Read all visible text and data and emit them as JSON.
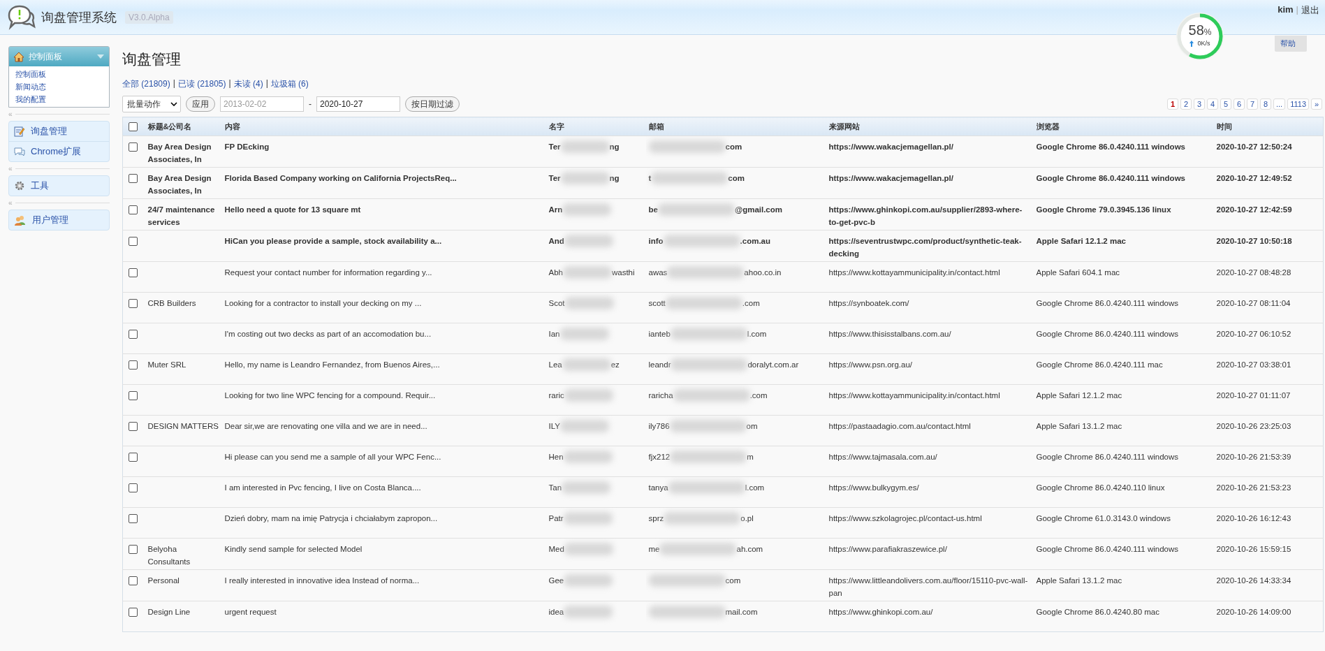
{
  "header": {
    "title": "询盘管理系统",
    "version": "V3.0.Alpha",
    "user": "kim",
    "separator": "|",
    "logout": "退出",
    "help": "帮助"
  },
  "monitor": {
    "percent": "58",
    "unit": "%",
    "level": 0.58,
    "speed": "0K/s"
  },
  "sidebar": {
    "panel": {
      "title": "控制面板",
      "items": [
        "控制面板",
        "新闻动态",
        "我的配置"
      ]
    },
    "groups": [
      {
        "collapse": "«",
        "items": [
          "询盘管理",
          "Chrome扩展"
        ]
      },
      {
        "collapse": "«",
        "items": [
          "工具"
        ]
      },
      {
        "collapse": "«",
        "items": [
          "用户管理"
        ]
      }
    ]
  },
  "page_title": "询盘管理",
  "filters": [
    {
      "label": "全部 (21809)"
    },
    {
      "sep": "|",
      "label": "已读 (21805)"
    },
    {
      "sep": "|",
      "label": "未读 (4)"
    },
    {
      "sep": "|",
      "label": "垃圾箱 (6)"
    }
  ],
  "toolbar": {
    "bulk_action": "批量动作",
    "apply": "应用",
    "date_from_placeholder": "2013-02-02",
    "dash": "-",
    "date_to": "2020-10-27",
    "filter_button": "按日期过滤"
  },
  "pagination": {
    "pages": [
      {
        "label": "1",
        "selected": true
      },
      {
        "label": "2",
        "selected": false
      },
      {
        "label": "3",
        "selected": false
      },
      {
        "label": "4",
        "selected": false
      },
      {
        "label": "5",
        "selected": false
      },
      {
        "label": "6",
        "selected": false
      },
      {
        "label": "7",
        "selected": false
      },
      {
        "label": "8",
        "selected": false
      },
      {
        "label": "...",
        "selected": false
      },
      {
        "label": "1113",
        "selected": false
      }
    ],
    "next": "»"
  },
  "table": {
    "select_all_checked": false,
    "columns": [
      "标题&公司名",
      "内容",
      "名字",
      "邮箱",
      "来源网站",
      "浏览器",
      "时间"
    ],
    "rows": [
      {
        "checked": false,
        "read": false,
        "company": "Bay Area Design Associates, In",
        "content": "FP DEcking",
        "name": {
          "start": "Ter",
          "end": "ng"
        },
        "email": {
          "end": "com"
        },
        "site": "https://www.wakacjemagellan.pl/",
        "browser": "Google Chrome 86.0.4240.111 windows",
        "time": "2020-10-27 12:50:24"
      },
      {
        "checked": false,
        "read": false,
        "company": "Bay Area Design Associates, In",
        "content": "Florida Based Company working on California ProjectsReq...",
        "name": {
          "start": "Ter",
          "end": "ng"
        },
        "email": {
          "start": "t",
          "end": "com"
        },
        "site": "https://www.wakacjemagellan.pl/",
        "browser": "Google Chrome 86.0.4240.111 windows",
        "time": "2020-10-27 12:49:52"
      },
      {
        "checked": false,
        "read": false,
        "company": "24/7 maintenance services",
        "content": "Hello need a quote for 13 square mt",
        "name": {
          "start": "Arn"
        },
        "email": {
          "start": "be",
          "end": "@gmail.com"
        },
        "site": "https://www.ghinkopi.com.au/supplier/2893-where-to-get-pvc-b",
        "browser": "Google Chrome 79.0.3945.136 linux",
        "time": "2020-10-27 12:42:59"
      },
      {
        "checked": false,
        "read": false,
        "content": "HiCan you please provide a sample, stock availability a...",
        "name": {
          "start": "And"
        },
        "email": {
          "start": "info",
          "end": ".com.au"
        },
        "site": "https://seventrustwpc.com/product/synthetic-teak-decking",
        "browser": "Apple Safari 12.1.2 mac",
        "time": "2020-10-27 10:50:18"
      },
      {
        "checked": false,
        "read": true,
        "content": "Request your contact number for information regarding y...",
        "name": {
          "start": "Abh",
          "end": "wasthi"
        },
        "email": {
          "start": "awas",
          "end": "ahoo.co.in"
        },
        "site": "https://www.kottayammunicipality.in/contact.html",
        "browser": "Apple Safari 604.1 mac",
        "time": "2020-10-27 08:48:28"
      },
      {
        "checked": false,
        "read": true,
        "company": "CRB Builders",
        "content": "Looking for a contractor to install your decking on my ...",
        "name": {
          "start": "Scot"
        },
        "email": {
          "start": "scott",
          "end": ".com"
        },
        "site": "https://synboatek.com/",
        "browser": "Google Chrome 86.0.4240.111 windows",
        "time": "2020-10-27 08:11:04"
      },
      {
        "checked": false,
        "read": true,
        "content": "I'm costing out two decks as part of an accomodation bu...",
        "name": {
          "start": "Ian"
        },
        "email": {
          "start": "ianteb",
          "end": "l.com"
        },
        "site": "https://www.thisisstalbans.com.au/",
        "browser": "Google Chrome 86.0.4240.111 windows",
        "time": "2020-10-27 06:10:52"
      },
      {
        "checked": false,
        "read": true,
        "company": "Muter SRL",
        "content": "Hello, my name is Leandro Fernandez, from Buenos Aires,...",
        "name": {
          "start": "Lea",
          "end": "ez"
        },
        "email": {
          "start": "leandr",
          "end": "doralyt.com.ar"
        },
        "site": "https://www.psn.org.au/",
        "browser": "Google Chrome 86.0.4240.111 mac",
        "time": "2020-10-27 03:38:01"
      },
      {
        "checked": false,
        "read": true,
        "content": "Looking for two line WPC fencing for a compound. Requir...",
        "name": {
          "start": "raric"
        },
        "email": {
          "start": "raricha",
          "end": ".com"
        },
        "site": "https://www.kottayammunicipality.in/contact.html",
        "browser": "Apple Safari 12.1.2 mac",
        "time": "2020-10-27 01:11:07"
      },
      {
        "checked": false,
        "read": true,
        "company": "DESIGN MATTERS",
        "content": "Dear sir,we are renovating one villa and we are in need...",
        "name": {
          "start": "ILY"
        },
        "email": {
          "start": "ily786",
          "end": "om"
        },
        "site": "https://pastaadagio.com.au/contact.html",
        "browser": "Apple Safari 13.1.2 mac",
        "time": "2020-10-26 23:25:03"
      },
      {
        "checked": false,
        "read": true,
        "content": "Hi please can you send me a sample of all your WPC Fenc...",
        "name": {
          "start": "Hen"
        },
        "email": {
          "start": "fjx212",
          "end": "m"
        },
        "site": "https://www.tajmasala.com.au/",
        "browser": "Google Chrome 86.0.4240.111 windows",
        "time": "2020-10-26 21:53:39"
      },
      {
        "checked": false,
        "read": true,
        "content": "I am interested in Pvc fencing, I live on Costa Blanca....",
        "name": {
          "start": "Tan"
        },
        "email": {
          "start": "tanya",
          "end": "l.com"
        },
        "site": "https://www.bulkygym.es/",
        "browser": "Google Chrome 86.0.4240.110 linux",
        "time": "2020-10-26 21:53:23"
      },
      {
        "checked": false,
        "read": true,
        "content": "Dzień dobry, mam na imię Patrycja i chciałabym zapropon...",
        "name": {
          "start": "Patr"
        },
        "email": {
          "start": "sprz",
          "end": "o.pl"
        },
        "site": "https://www.szkolagrojec.pl/contact-us.html",
        "browser": "Google Chrome 61.0.3143.0 windows",
        "time": "2020-10-26 16:12:43"
      },
      {
        "checked": false,
        "read": true,
        "company": "Belyoha Consultants",
        "content": "Kindly send sample for selected Model",
        "name": {
          "start": "Med"
        },
        "email": {
          "start": "me",
          "end": "ah.com"
        },
        "site": "https://www.parafiakraszewice.pl/",
        "browser": "Google Chrome 86.0.4240.111 windows",
        "time": "2020-10-26 15:59:15"
      },
      {
        "checked": false,
        "read": true,
        "company": "Personal",
        "content": "I really interested in innovative idea Instead of norma...",
        "name": {
          "start": "Gee"
        },
        "email": {
          "end": "com"
        },
        "site": "https://www.littleandolivers.com.au/floor/15110-pvc-wall-pan",
        "browser": "Apple Safari 13.1.2 mac",
        "time": "2020-10-26 14:33:34"
      },
      {
        "checked": false,
        "read": true,
        "company": "Design Line",
        "content": "urgent request",
        "name": {
          "start": "idea"
        },
        "email": {
          "end": "mail.com"
        },
        "site": "https://www.ghinkopi.com.au/",
        "browser": "Google Chrome 86.0.4240.80 mac",
        "time": "2020-10-26 14:09:00"
      }
    ]
  }
}
